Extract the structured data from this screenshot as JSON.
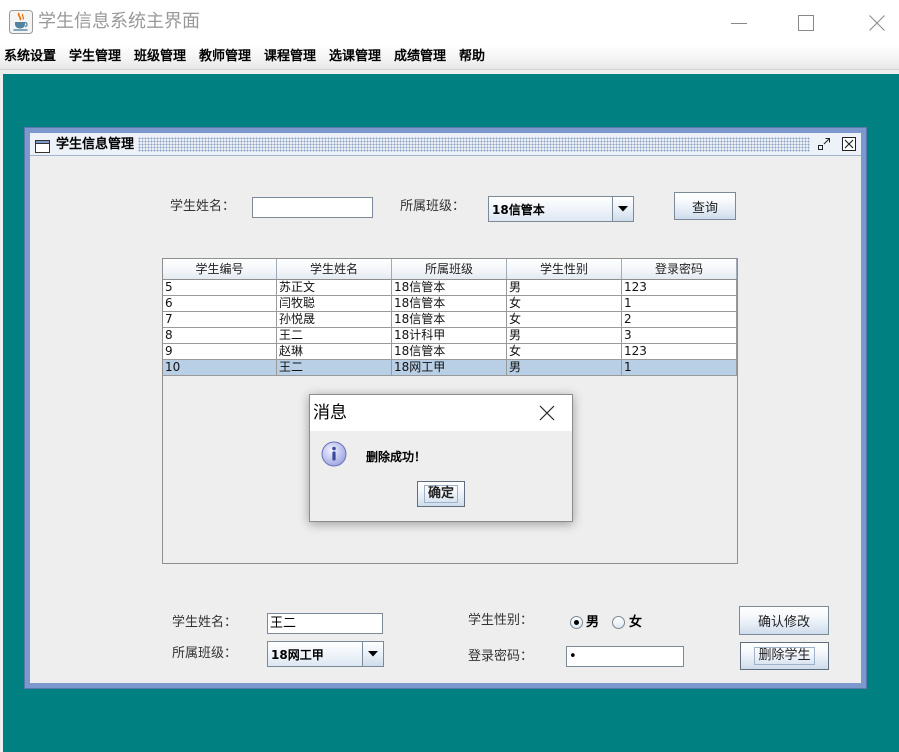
{
  "window": {
    "title": "学生信息系统主界面"
  },
  "menu": [
    {
      "label": "系统设置"
    },
    {
      "label": "学生管理"
    },
    {
      "label": "班级管理"
    },
    {
      "label": "教师管理"
    },
    {
      "label": "课程管理"
    },
    {
      "label": "选课管理"
    },
    {
      "label": "成绩管理"
    },
    {
      "label": "帮助"
    }
  ],
  "internal_frame": {
    "title": "学生信息管理",
    "search": {
      "name_label": "学生姓名：",
      "name_value": "",
      "class_label": "所属班级：",
      "class_selected": "18信管本",
      "query_button": "查询"
    },
    "table": {
      "columns": [
        "学生编号",
        "学生姓名",
        "所属班级",
        "学生性别",
        "登录密码"
      ],
      "rows": [
        {
          "cells": [
            "5",
            "苏正文",
            "18信管本",
            "男",
            "123"
          ],
          "selected": false
        },
        {
          "cells": [
            "6",
            "闫牧聪",
            "18信管本",
            "女",
            "1"
          ],
          "selected": false
        },
        {
          "cells": [
            "7",
            "孙悦晟",
            "18信管本",
            "女",
            "2"
          ],
          "selected": false
        },
        {
          "cells": [
            "8",
            "王二",
            "18计科甲",
            "男",
            "3"
          ],
          "selected": false
        },
        {
          "cells": [
            "9",
            "赵琳",
            "18信管本",
            "女",
            "123"
          ],
          "selected": false
        },
        {
          "cells": [
            "10",
            "王二",
            "18网工甲",
            "男",
            "1"
          ],
          "selected": true
        }
      ]
    },
    "edit": {
      "name_label": "学生姓名：",
      "name_value": "王二",
      "class_label": "所属班级：",
      "class_selected": "18网工甲",
      "gender_label": "学生性别：",
      "gender_options": [
        {
          "label": "男",
          "selected": true
        },
        {
          "label": "女",
          "selected": false
        }
      ],
      "password_label": "登录密码：",
      "password_value": "•",
      "confirm_button": "确认修改",
      "delete_button": "删除学生"
    }
  },
  "dialog": {
    "title": "消息",
    "message": "删除成功！",
    "ok_button": "确定"
  },
  "icons": {
    "app": "java-coffee-icon",
    "minimize": "minimize-icon",
    "maximize": "maximize-icon",
    "close": "close-icon",
    "frame": "window-icon",
    "frame_iconify": "restore-arrows-icon",
    "frame_close": "close-box-icon",
    "combo_arrow": "chevron-down-icon",
    "dialog_info": "info-icon",
    "dialog_close": "close-icon"
  },
  "colors": {
    "desktop": "#008080",
    "frame_body": "#EEEEEE",
    "frame_border": "#7C98CD",
    "selected_row": "#B8CFE5",
    "control_border": "#7A8A99",
    "inactive_title_text": "#999999"
  }
}
